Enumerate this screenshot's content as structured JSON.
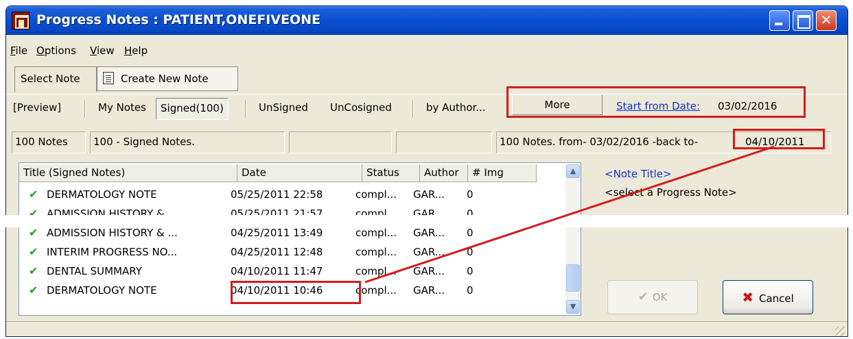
{
  "window": {
    "title": "Progress Notes : PATIENT,ONEFIVEONE",
    "close_glyph": "✕"
  },
  "menu": [
    "File",
    "Options",
    "View",
    "Help"
  ],
  "tabs": [
    {
      "label": "Select Note"
    },
    {
      "label": "Create New Note"
    }
  ],
  "filters": {
    "preview": "[Preview]",
    "my_notes": "My Notes",
    "signed": "Signed(100)",
    "unsigned": "UnSigned",
    "uncosigned": "UnCosigned",
    "by_author": "by Author...",
    "more": "More",
    "start_label": "Start from Date:",
    "start_date": "03/02/2016"
  },
  "status": {
    "count": "100 Notes",
    "desc": "100 - Signed Notes.",
    "range_prefix": "100 Notes.  from- 03/02/2016  -back to-",
    "range_end": "04/10/2011"
  },
  "columns": [
    "Title  (Signed Notes)",
    "Date",
    "Status",
    "Author",
    "# Img"
  ],
  "rows": [
    {
      "title": "DERMATOLOGY NOTE",
      "date": "05/25/2011 22:58",
      "status": "compl...",
      "author": "GAR...",
      "img": "0"
    },
    {
      "title": "ADMISSION HISTORY &...",
      "date": "05/25/2011 21:57",
      "status": "compl...",
      "author": "GAR...",
      "img": "0"
    },
    {
      "title": "ADMISSION HISTORY & ...",
      "date": "04/25/2011 13:49",
      "status": "compl...",
      "author": "GAR...",
      "img": "0"
    },
    {
      "title": "INTERIM PROGRESS NO...",
      "date": "04/25/2011 12:48",
      "status": "compl...",
      "author": "GAR...",
      "img": "0"
    },
    {
      "title": "DENTAL SUMMARY",
      "date": "04/10/2011 11:47",
      "status": "compl...",
      "author": "GAR...",
      "img": "0"
    },
    {
      "title": "DERMATOLOGY NOTE",
      "date": "04/10/2011 10:46",
      "status": "compl...",
      "author": "GAR...",
      "img": "0"
    }
  ],
  "preview": {
    "title": "<Note Title>",
    "hint": "<select a Progress Note>"
  },
  "buttons": {
    "ok": "OK",
    "cancel": "Cancel"
  },
  "colors": {
    "highlight_box": "#d41a1a",
    "link": "#1133cc",
    "check": "#1fa31f"
  }
}
